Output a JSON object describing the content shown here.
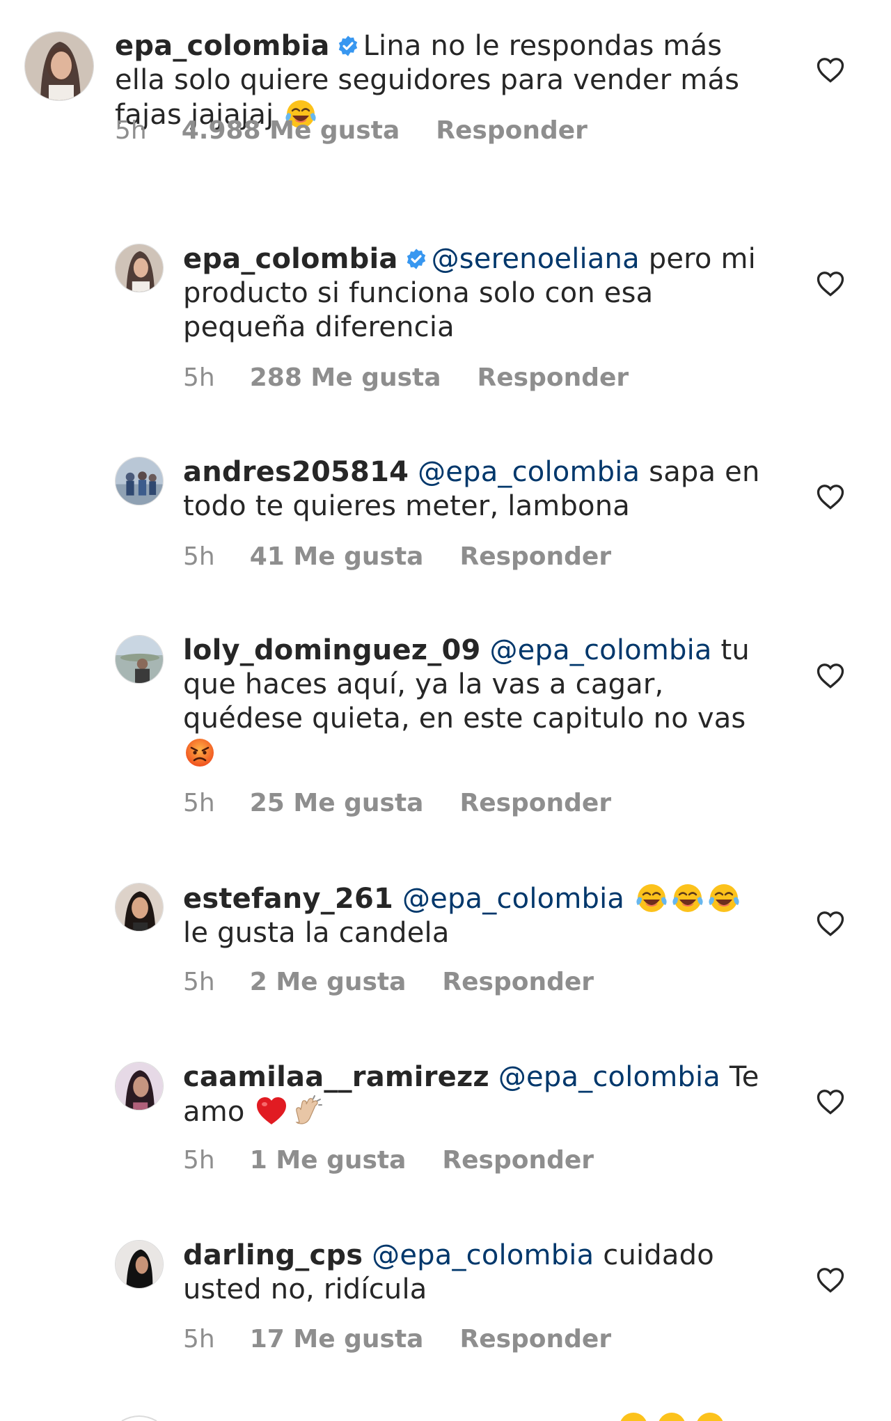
{
  "comments": [
    {
      "username": "epa_colombia",
      "verified": true,
      "mention": "",
      "text": "Lina no le respondas más ella solo quiere seguidores para vender más fajas jajajaj",
      "emojis": [
        "😂"
      ],
      "time": "5h",
      "likes": "4.988 Me gusta",
      "reply": "Responder"
    },
    {
      "username": "epa_colombia",
      "verified": true,
      "mention": "@serenoeliana",
      "text": " pero mi producto si funciona solo con esa pequeña diferencia",
      "emojis": [],
      "time": "5h",
      "likes": "288 Me gusta",
      "reply": "Responder"
    },
    {
      "username": "andres205814",
      "verified": false,
      "mention": "@epa_colombia",
      "text": " sapa en todo te quieres meter, lambona",
      "emojis": [],
      "time": "5h",
      "likes": "41 Me gusta",
      "reply": "Responder"
    },
    {
      "username": "loly_dominguez_09",
      "verified": false,
      "mention": "@epa_colombia",
      "text": "tu que haces aquí, ya la vas a cagar, quédese quieta, en este capitulo no vas",
      "emojis": [
        "😡"
      ],
      "time": "5h",
      "likes": "25 Me gusta",
      "reply": "Responder"
    },
    {
      "username": "estefany_261",
      "verified": false,
      "mention": "@epa_colombia",
      "text": "le gusta la candela",
      "emojis": [
        "😂",
        "😂",
        "😂"
      ],
      "time": "5h",
      "likes": "2 Me gusta",
      "reply": "Responder"
    },
    {
      "username": "caamilaa__ramirezz",
      "verified": false,
      "mention": "@epa_colombia",
      "text": "Te amo",
      "emojis": [
        "❤️",
        "👏🏼"
      ],
      "time": "5h",
      "likes": "1 Me gusta",
      "reply": "Responder"
    },
    {
      "username": "darling_cps",
      "verified": false,
      "mention": "@epa_colombia",
      "text": "cuidado usted no, ridícula",
      "emojis": [],
      "time": "5h",
      "likes": "17 Me gusta",
      "reply": "Responder"
    }
  ],
  "icons": {
    "like": "heart-outline-icon",
    "verified": "verified-badge-icon"
  },
  "colors": {
    "mention": "#00376b",
    "meta": "#8e8e8e",
    "text": "#262626",
    "verified": "#3897f0"
  }
}
